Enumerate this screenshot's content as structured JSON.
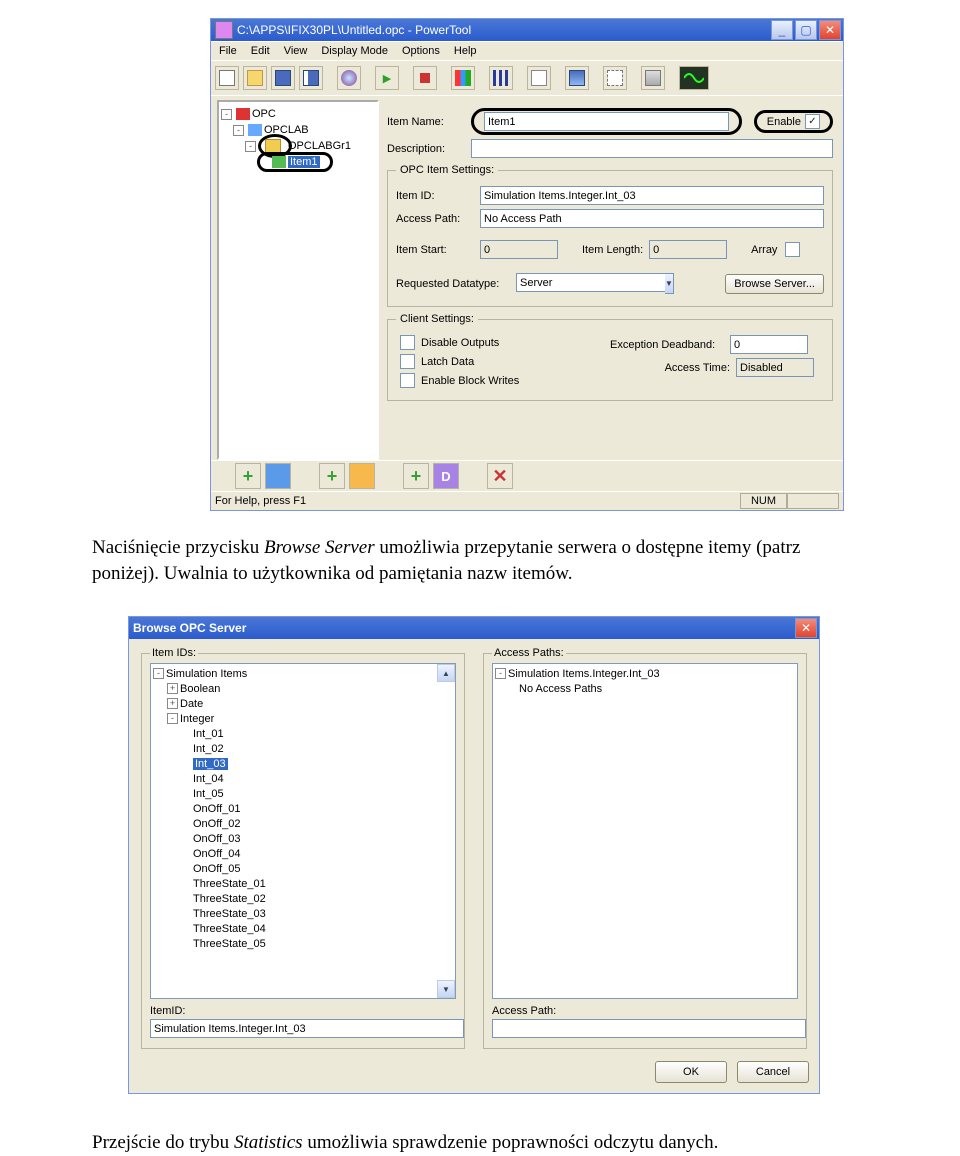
{
  "window": {
    "title": "C:\\APPS\\IFIX30PL\\Untitled.opc - PowerTool",
    "menu": [
      "File",
      "Edit",
      "View",
      "Display Mode",
      "Options",
      "Help"
    ],
    "statusHelp": "For Help, press F1",
    "statusNum": "NUM"
  },
  "tree": {
    "root": "OPC",
    "server": "OPCLAB",
    "group": "OPCLABGr1",
    "item": "Item1"
  },
  "form": {
    "itemNameLabel": "Item Name:",
    "itemName": "Item1",
    "enableLabel": "Enable",
    "enableChecked": "✓",
    "descLabel": "Description:",
    "desc": ""
  },
  "opc": {
    "legend": "OPC Item Settings:",
    "itemIdLabel": "Item ID:",
    "itemId": "Simulation Items.Integer.Int_03",
    "accessPathLabel": "Access Path:",
    "accessPath": "No Access Path",
    "itemStartLabel": "Item Start:",
    "itemStart": "0",
    "itemLengthLabel": "Item Length:",
    "itemLength": "0",
    "arrayLabel": "Array",
    "reqTypeLabel": "Requested Datatype:",
    "reqType": "Server",
    "browseBtn": "Browse Server..."
  },
  "client": {
    "legend": "Client Settings:",
    "disableOutputs": "Disable Outputs",
    "latchData": "Latch Data",
    "enableBlockWrites": "Enable Block Writes",
    "exceptionLabel": "Exception Deadband:",
    "exception": "0",
    "accessTimeLabel": "Access Time:",
    "accessTime": "Disabled"
  },
  "doc": {
    "p1a": "Naciśnięcie przycisku ",
    "p1it": "Browse Server",
    "p1b": " umożliwia przepytanie serwera o dostępne itemy (patrz poniżej). Uwalnia to użytkownika od pamiętania nazw itemów.",
    "p2a": "Przejście do trybu ",
    "p2it": "Statistics",
    "p2b": " umożliwia sprawdzenie poprawności odczytu danych."
  },
  "dialog": {
    "title": "Browse OPC Server",
    "leftLegend": "Item IDs:",
    "rightLegend": "Access Paths:",
    "leftTree": {
      "root": "Simulation Items",
      "branches": [
        "Boolean",
        "Date",
        "Integer"
      ],
      "ints": [
        "Int_01",
        "Int_02",
        "Int_03",
        "Int_04",
        "Int_05",
        "OnOff_01",
        "OnOff_02",
        "OnOff_03",
        "OnOff_04",
        "OnOff_05",
        "ThreeState_01",
        "ThreeState_02",
        "ThreeState_03",
        "ThreeState_04",
        "ThreeState_05"
      ],
      "selected": "Int_03"
    },
    "rightTree": {
      "root": "Simulation Items.Integer.Int_03",
      "child": "No Access Paths"
    },
    "itemIdLabel": "ItemID:",
    "itemId": "Simulation Items.Integer.Int_03",
    "accessPathLabel": "Access Path:",
    "accessPath": "",
    "ok": "OK",
    "cancel": "Cancel"
  }
}
